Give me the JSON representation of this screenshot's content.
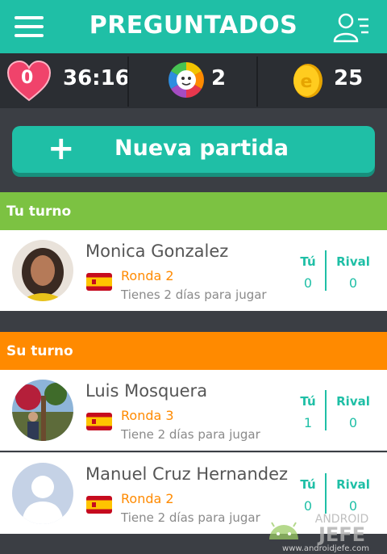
{
  "header": {
    "title": "PREGUNTADOS"
  },
  "stats": {
    "lives": "0",
    "timer": "36:16",
    "spins": "2",
    "coins": "25"
  },
  "new_game": {
    "label": "Nueva partida"
  },
  "sections": {
    "your_turn": "Tu turno",
    "their_turn": "Su turno"
  },
  "games": [
    {
      "name": "Monica Gonzalez",
      "round": "Ronda 2",
      "days": "Tienes 2 días para jugar",
      "you_label": "Tú",
      "rival_label": "Rival",
      "you": "0",
      "rival": "0"
    },
    {
      "name": "Luis Mosquera",
      "round": "Ronda 3",
      "days": "Tiene 2 días para jugar",
      "you_label": "Tú",
      "rival_label": "Rival",
      "you": "1",
      "rival": "0"
    },
    {
      "name": "Manuel Cruz Hernandez",
      "round": "Ronda 2",
      "days": "Tiene 2 días para jugar",
      "you_label": "Tú",
      "rival_label": "Rival",
      "you": "0",
      "rival": "0"
    }
  ],
  "watermark": {
    "line1": "ANDROID",
    "line2": "JEFE",
    "url": "www.androidjefe.com"
  },
  "colors": {
    "teal": "#1fbfa6",
    "green": "#7cc242",
    "orange": "#ff8a00",
    "dark": "#2b2e33"
  },
  "icons": [
    "menu-icon",
    "profile-icon",
    "heart-icon",
    "spin-wheel-icon",
    "coin-icon",
    "plus-icon",
    "spain-flag-icon"
  ]
}
